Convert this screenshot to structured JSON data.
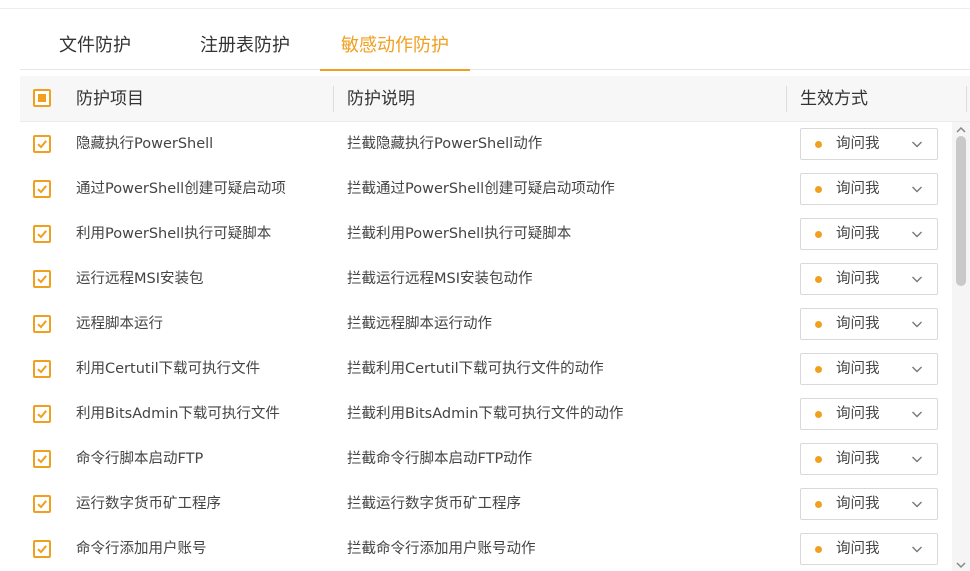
{
  "tabs": [
    {
      "label": "文件防护"
    },
    {
      "label": "注册表防护"
    },
    {
      "label": "敏感动作防护",
      "active": true
    }
  ],
  "table": {
    "headers": {
      "item": "防护项目",
      "desc": "防护说明",
      "mode": "生效方式"
    },
    "rows": [
      {
        "item": "隐藏执行PowerShell",
        "desc": "拦截隐藏执行PowerShell动作",
        "mode": "询问我",
        "checked": true
      },
      {
        "item": "通过PowerShell创建可疑启动项",
        "desc": "拦截通过PowerShell创建可疑启动项动作",
        "mode": "询问我",
        "checked": true
      },
      {
        "item": "利用PowerShell执行可疑脚本",
        "desc": "拦截利用PowerShell执行可疑脚本",
        "mode": "询问我",
        "checked": true
      },
      {
        "item": "运行远程MSI安装包",
        "desc": "拦截运行远程MSI安装包动作",
        "mode": "询问我",
        "checked": true
      },
      {
        "item": "远程脚本运行",
        "desc": "拦截远程脚本运行动作",
        "mode": "询问我",
        "checked": true
      },
      {
        "item": "利用Certutil下载可执行文件",
        "desc": "拦截利用Certutil下载可执行文件的动作",
        "mode": "询问我",
        "checked": true
      },
      {
        "item": "利用BitsAdmin下载可执行文件",
        "desc": "拦截利用BitsAdmin下载可执行文件的动作",
        "mode": "询问我",
        "checked": true
      },
      {
        "item": "命令行脚本启动FTP",
        "desc": "拦截命令行脚本启动FTP动作",
        "mode": "询问我",
        "checked": true
      },
      {
        "item": "运行数字货币矿工程序",
        "desc": "拦截运行数字货币矿工程序",
        "mode": "询问我",
        "checked": true
      },
      {
        "item": "命令行添加用户账号",
        "desc": "拦截命令行添加用户账号动作",
        "mode": "询问我",
        "checked": true
      }
    ]
  },
  "icons": {
    "row_checkbox": "checkmark-icon",
    "select_indicator": "status-dot-icon",
    "select_arrow": "chevron-down-icon"
  },
  "colors": {
    "accent": "#f0a020",
    "status_dot": "#f0a020"
  }
}
